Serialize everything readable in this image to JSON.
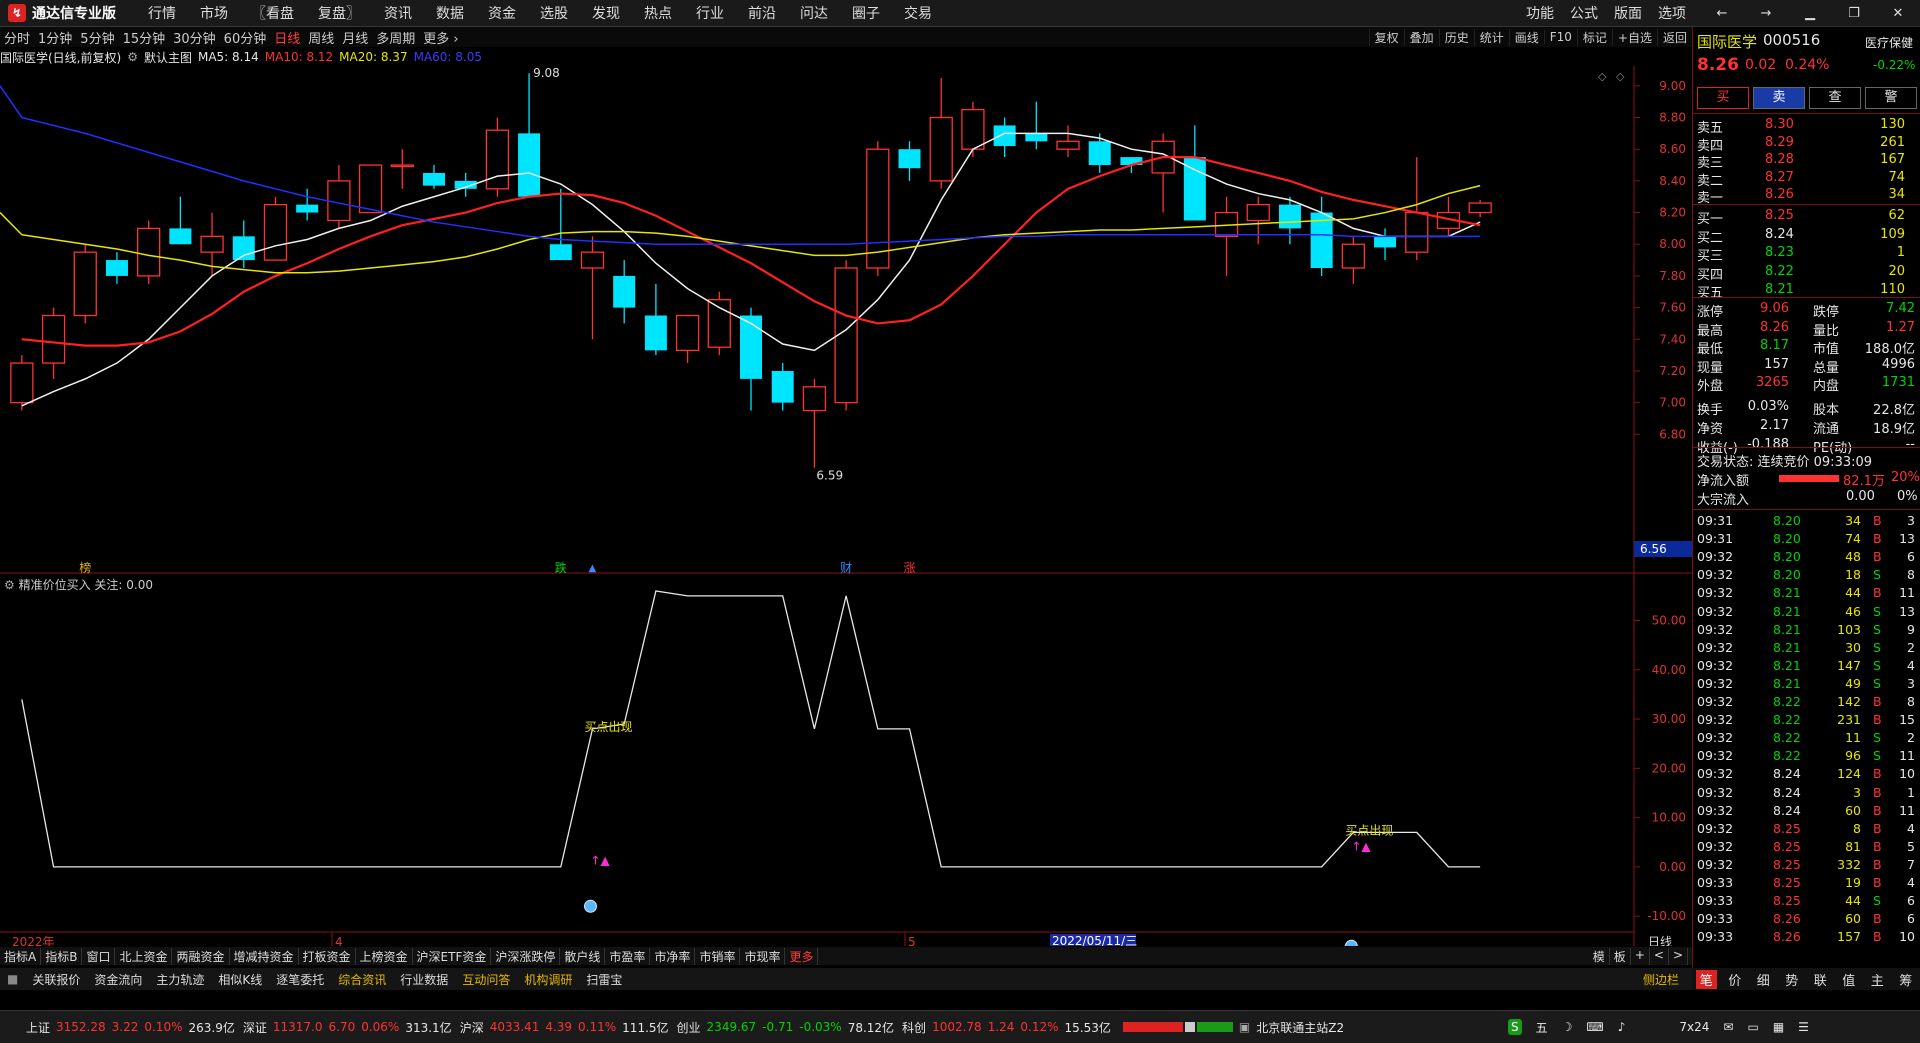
{
  "app": {
    "title": "通达信专业版"
  },
  "menu": [
    "行情",
    "市场",
    "〖看盘",
    "复盘〗",
    "资讯",
    "数据",
    "资金",
    "选股",
    "发现",
    "热点",
    "行业",
    "前沿",
    "问达",
    "圈子",
    "交易"
  ],
  "topright": [
    "功能",
    "公式",
    "版面",
    "选项"
  ],
  "periods": [
    "分时",
    "1分钟",
    "5分钟",
    "15分钟",
    "30分钟",
    "60分钟",
    "日线",
    "周线",
    "月线",
    "多周期",
    "更多 ›"
  ],
  "active_period": "日线",
  "chart_tools": [
    "复权",
    "叠加",
    "历史",
    "统计",
    "画线",
    "F10",
    "标记",
    "+自选",
    "返回"
  ],
  "infoline": {
    "name": "国际医学(日线,前复权)",
    "template": "默认主图",
    "ma5": "MA5: 8.14",
    "ma10": "MA10: 8.12",
    "ma20": "MA20: 8.37",
    "ma60": "MA60: 8.05"
  },
  "indicator_line": "精准价位买入 关注: 0.00",
  "chart_data": [
    {
      "type": "candlestick",
      "title": "国际医学(日线,前复权)",
      "ylim": [
        6.6,
        9.1
      ],
      "y_ticks": [
        "9.00",
        "8.80",
        "8.60",
        "8.40",
        "8.20",
        "8.00",
        "7.80",
        "7.60",
        "7.40",
        "7.20",
        "7.00",
        "6.80"
      ],
      "annotations": [
        {
          "text": "9.08",
          "value": 9.08
        },
        {
          "text": "6.59",
          "value": 6.59
        }
      ],
      "current_price_tag": "6.56",
      "x_tick_labels": [
        "2022年",
        "4",
        "5"
      ],
      "cursor_date": "2022/05/11/三",
      "event_marks": [
        "榜",
        "跌",
        "财",
        "涨"
      ],
      "candles": [
        {
          "o": 7.0,
          "h": 7.3,
          "l": 6.95,
          "c": 7.25
        },
        {
          "o": 7.25,
          "h": 7.6,
          "l": 7.15,
          "c": 7.55
        },
        {
          "o": 7.55,
          "h": 8.0,
          "l": 7.5,
          "c": 7.95
        },
        {
          "o": 7.9,
          "h": 7.95,
          "l": 7.75,
          "c": 7.8
        },
        {
          "o": 7.8,
          "h": 8.15,
          "l": 7.75,
          "c": 8.1
        },
        {
          "o": 8.1,
          "h": 8.3,
          "l": 8.0,
          "c": 8.0
        },
        {
          "o": 7.95,
          "h": 8.2,
          "l": 7.8,
          "c": 8.05
        },
        {
          "o": 8.05,
          "h": 8.15,
          "l": 7.85,
          "c": 7.9
        },
        {
          "o": 7.9,
          "h": 8.3,
          "l": 7.9,
          "c": 8.25
        },
        {
          "o": 8.25,
          "h": 8.35,
          "l": 8.15,
          "c": 8.2
        },
        {
          "o": 8.15,
          "h": 8.5,
          "l": 8.1,
          "c": 8.4
        },
        {
          "o": 8.2,
          "h": 8.5,
          "l": 8.2,
          "c": 8.5
        },
        {
          "o": 8.5,
          "h": 8.6,
          "l": 8.35,
          "c": 8.5
        },
        {
          "o": 8.45,
          "h": 8.5,
          "l": 8.35,
          "c": 8.37
        },
        {
          "o": 8.4,
          "h": 8.45,
          "l": 8.3,
          "c": 8.35
        },
        {
          "o": 8.35,
          "h": 8.8,
          "l": 8.3,
          "c": 8.72
        },
        {
          "o": 8.7,
          "h": 9.08,
          "l": 8.3,
          "c": 8.3
        },
        {
          "o": 8.0,
          "h": 8.35,
          "l": 7.9,
          "c": 7.9
        },
        {
          "o": 7.85,
          "h": 8.05,
          "l": 7.4,
          "c": 7.95
        },
        {
          "o": 7.8,
          "h": 7.9,
          "l": 7.5,
          "c": 7.6
        },
        {
          "o": 7.55,
          "h": 7.75,
          "l": 7.3,
          "c": 7.33
        },
        {
          "o": 7.33,
          "h": 7.5,
          "l": 7.25,
          "c": 7.55
        },
        {
          "o": 7.35,
          "h": 7.7,
          "l": 7.3,
          "c": 7.65
        },
        {
          "o": 7.55,
          "h": 7.6,
          "l": 6.95,
          "c": 7.15
        },
        {
          "o": 7.2,
          "h": 7.25,
          "l": 6.95,
          "c": 7.0
        },
        {
          "o": 6.95,
          "h": 7.15,
          "l": 6.59,
          "c": 7.1
        },
        {
          "o": 7.0,
          "h": 7.9,
          "l": 6.95,
          "c": 7.85
        },
        {
          "o": 7.85,
          "h": 8.65,
          "l": 7.8,
          "c": 8.6
        },
        {
          "o": 8.6,
          "h": 8.65,
          "l": 8.4,
          "c": 8.48
        },
        {
          "o": 8.4,
          "h": 9.05,
          "l": 8.35,
          "c": 8.8
        },
        {
          "o": 8.6,
          "h": 8.9,
          "l": 8.55,
          "c": 8.85
        },
        {
          "o": 8.75,
          "h": 8.8,
          "l": 8.55,
          "c": 8.62
        },
        {
          "o": 8.7,
          "h": 8.9,
          "l": 8.6,
          "c": 8.65
        },
        {
          "o": 8.6,
          "h": 8.75,
          "l": 8.55,
          "c": 8.65
        },
        {
          "o": 8.65,
          "h": 8.7,
          "l": 8.45,
          "c": 8.5
        },
        {
          "o": 8.55,
          "h": 8.55,
          "l": 8.45,
          "c": 8.5
        },
        {
          "o": 8.45,
          "h": 8.7,
          "l": 8.2,
          "c": 8.65
        },
        {
          "o": 8.55,
          "h": 8.75,
          "l": 8.15,
          "c": 8.15
        },
        {
          "o": 8.05,
          "h": 8.3,
          "l": 7.8,
          "c": 8.2
        },
        {
          "o": 8.15,
          "h": 8.3,
          "l": 8.0,
          "c": 8.25
        },
        {
          "o": 8.25,
          "h": 8.3,
          "l": 8.0,
          "c": 8.1
        },
        {
          "o": 8.2,
          "h": 8.3,
          "l": 7.8,
          "c": 7.85
        },
        {
          "o": 7.85,
          "h": 8.05,
          "l": 7.75,
          "c": 8.0
        },
        {
          "o": 8.05,
          "h": 8.1,
          "l": 7.9,
          "c": 7.98
        },
        {
          "o": 7.95,
          "h": 8.55,
          "l": 7.9,
          "c": 8.2
        },
        {
          "o": 8.1,
          "h": 8.3,
          "l": 8.05,
          "c": 8.2
        },
        {
          "o": 8.2,
          "h": 8.28,
          "l": 8.17,
          "c": 8.26
        }
      ],
      "ma_lines": {
        "MA5": [
          6.98,
          7.07,
          7.15,
          7.25,
          7.4,
          7.6,
          7.8,
          7.93,
          7.99,
          8.03,
          8.1,
          8.15,
          8.24,
          8.3,
          8.36,
          8.43,
          8.45,
          8.38,
          8.25,
          8.08,
          7.88,
          7.72,
          7.6,
          7.5,
          7.37,
          7.33,
          7.46,
          7.65,
          7.9,
          8.28,
          8.6,
          8.7,
          8.7,
          8.7,
          8.67,
          8.6,
          8.57,
          8.47,
          8.38,
          8.32,
          8.28,
          8.2,
          8.1,
          8.05,
          8.05,
          8.05,
          8.14
        ],
        "MA10": [
          7.4,
          7.38,
          7.36,
          7.36,
          7.38,
          7.45,
          7.56,
          7.7,
          7.8,
          7.88,
          7.97,
          8.05,
          8.12,
          8.16,
          8.2,
          8.26,
          8.3,
          8.32,
          8.31,
          8.26,
          8.18,
          8.08,
          7.98,
          7.88,
          7.76,
          7.64,
          7.55,
          7.5,
          7.52,
          7.62,
          7.8,
          8.0,
          8.2,
          8.35,
          8.43,
          8.5,
          8.55,
          8.55,
          8.5,
          8.45,
          8.4,
          8.33,
          8.28,
          8.24,
          8.2,
          8.16,
          8.12
        ],
        "MA20": [
          8.06,
          8.03,
          8.0,
          7.97,
          7.93,
          7.9,
          7.86,
          7.84,
          7.82,
          7.82,
          7.83,
          7.85,
          7.87,
          7.89,
          7.92,
          7.97,
          8.03,
          8.07,
          8.08,
          8.08,
          8.07,
          8.05,
          8.02,
          7.99,
          7.96,
          7.93,
          7.93,
          7.95,
          7.98,
          8.01,
          8.04,
          8.06,
          8.07,
          8.08,
          8.09,
          8.09,
          8.1,
          8.11,
          8.12,
          8.13,
          8.14,
          8.15,
          8.16,
          8.2,
          8.25,
          8.32,
          8.37
        ],
        "MA60": [
          8.8,
          8.75,
          8.7,
          8.64,
          8.58,
          8.52,
          8.46,
          8.4,
          8.35,
          8.3,
          8.26,
          8.22,
          8.18,
          8.14,
          8.11,
          8.08,
          8.05,
          8.03,
          8.02,
          8.01,
          8.0,
          8.0,
          8.0,
          8.0,
          8.0,
          8.0,
          8.0,
          8.01,
          8.02,
          8.03,
          8.04,
          8.05,
          8.05,
          8.06,
          8.06,
          8.06,
          8.06,
          8.06,
          8.06,
          8.06,
          8.06,
          8.06,
          8.05,
          8.05,
          8.05,
          8.05,
          8.05
        ]
      }
    },
    {
      "type": "line",
      "title": "精准价位买入",
      "ylim": [
        -12,
        57
      ],
      "y_ticks": [
        "50.00",
        "40.00",
        "30.00",
        "20.00",
        "10.00",
        "0.00",
        "-10.00"
      ],
      "values": [
        34,
        0,
        0,
        0,
        0,
        0,
        0,
        0,
        0,
        0,
        0,
        0,
        0,
        0,
        0,
        0,
        0,
        0,
        28,
        29,
        56,
        55,
        55,
        55,
        55,
        28,
        55,
        28,
        28,
        0,
        0,
        0,
        0,
        0,
        0,
        0,
        0,
        0,
        0,
        0,
        0,
        0,
        7,
        7,
        7,
        0,
        0
      ],
      "annotations": [
        {
          "text": "买点出现",
          "index": 18
        },
        {
          "text": "买点出现",
          "index": 42
        }
      ]
    }
  ],
  "bottom_x_label": "日线",
  "stock": {
    "name": "国际医学",
    "code": "000516",
    "sector": "医疗保健",
    "sector_change": "-0.22%",
    "price": "8.26",
    "change": "0.02",
    "change_pct": "0.24%"
  },
  "trade_buttons": [
    "买",
    "卖",
    "查",
    "警"
  ],
  "order_book": {
    "asks": [
      {
        "label": "卖五",
        "price": "8.30",
        "vol": "130"
      },
      {
        "label": "卖四",
        "price": "8.29",
        "vol": "261"
      },
      {
        "label": "卖三",
        "price": "8.28",
        "vol": "167"
      },
      {
        "label": "卖二",
        "price": "8.27",
        "vol": "74"
      },
      {
        "label": "卖一",
        "price": "8.26",
        "vol": "34"
      }
    ],
    "bids": [
      {
        "label": "买一",
        "price": "8.25",
        "vol": "62"
      },
      {
        "label": "买二",
        "price": "8.24",
        "vol": "109"
      },
      {
        "label": "买三",
        "price": "8.23",
        "vol": "1"
      },
      {
        "label": "买四",
        "price": "8.22",
        "vol": "20"
      },
      {
        "label": "买五",
        "price": "8.21",
        "vol": "110"
      }
    ]
  },
  "stats": [
    {
      "k1": "涨停",
      "v1": "9.06",
      "k2": "跌停",
      "v2": "7.42",
      "c1": "red",
      "c2": "green"
    },
    {
      "k1": "最高",
      "v1": "8.26",
      "k2": "量比",
      "v2": "1.27",
      "c1": "red",
      "c2": "red"
    },
    {
      "k1": "最低",
      "v1": "8.17",
      "k2": "市值",
      "v2": "188.0亿",
      "c1": "green",
      "c2": "white"
    },
    {
      "k1": "现量",
      "v1": "157",
      "k2": "总量",
      "v2": "4996",
      "c1": "white",
      "c2": "white"
    },
    {
      "k1": "外盘",
      "v1": "3265",
      "k2": "内盘",
      "v2": "1731",
      "c1": "red",
      "c2": "green"
    },
    {
      "k1": "换手",
      "v1": "0.03%",
      "k2": "股本",
      "v2": "22.8亿",
      "c1": "white",
      "c2": "white"
    },
    {
      "k1": "净资",
      "v1": "2.17",
      "k2": "流通",
      "v2": "18.9亿",
      "c1": "white",
      "c2": "white"
    },
    {
      "k1": "收益(-)",
      "v1": "-0.188",
      "k2": "PE(动)",
      "v2": "--",
      "c1": "white",
      "c2": "white"
    }
  ],
  "trade_status": "交易状态: 连续竞价 09:33:09",
  "net_inflow": {
    "label": "净流入额",
    "value": "82.1万",
    "pct": "20%"
  },
  "block_inflow": {
    "label": "大宗流入",
    "value": "0.00",
    "pct": "0%"
  },
  "ticks": [
    {
      "t": "09:31",
      "p": "8.20",
      "v": "34",
      "d": "B",
      "n": "3"
    },
    {
      "t": "09:31",
      "p": "8.20",
      "v": "74",
      "d": "B",
      "n": "13"
    },
    {
      "t": "09:32",
      "p": "8.20",
      "v": "48",
      "d": "B",
      "n": "6"
    },
    {
      "t": "09:32",
      "p": "8.20",
      "v": "18",
      "d": "S",
      "n": "8"
    },
    {
      "t": "09:32",
      "p": "8.21",
      "v": "44",
      "d": "B",
      "n": "11"
    },
    {
      "t": "09:32",
      "p": "8.21",
      "v": "46",
      "d": "S",
      "n": "13"
    },
    {
      "t": "09:32",
      "p": "8.21",
      "v": "103",
      "d": "S",
      "n": "9"
    },
    {
      "t": "09:32",
      "p": "8.21",
      "v": "30",
      "d": "S",
      "n": "2"
    },
    {
      "t": "09:32",
      "p": "8.21",
      "v": "147",
      "d": "S",
      "n": "4"
    },
    {
      "t": "09:32",
      "p": "8.21",
      "v": "49",
      "d": "S",
      "n": "3"
    },
    {
      "t": "09:32",
      "p": "8.22",
      "v": "142",
      "d": "B",
      "n": "8"
    },
    {
      "t": "09:32",
      "p": "8.22",
      "v": "231",
      "d": "B",
      "n": "15"
    },
    {
      "t": "09:32",
      "p": "8.22",
      "v": "11",
      "d": "S",
      "n": "2"
    },
    {
      "t": "09:32",
      "p": "8.22",
      "v": "96",
      "d": "S",
      "n": "11"
    },
    {
      "t": "09:32",
      "p": "8.24",
      "v": "124",
      "d": "B",
      "n": "10"
    },
    {
      "t": "09:32",
      "p": "8.24",
      "v": "3",
      "d": "B",
      "n": "1"
    },
    {
      "t": "09:32",
      "p": "8.24",
      "v": "60",
      "d": "B",
      "n": "11"
    },
    {
      "t": "09:32",
      "p": "8.25",
      "v": "8",
      "d": "B",
      "n": "4"
    },
    {
      "t": "09:32",
      "p": "8.25",
      "v": "81",
      "d": "B",
      "n": "5"
    },
    {
      "t": "09:32",
      "p": "8.25",
      "v": "332",
      "d": "B",
      "n": "7"
    },
    {
      "t": "09:33",
      "p": "8.25",
      "v": "19",
      "d": "B",
      "n": "4"
    },
    {
      "t": "09:33",
      "p": "8.25",
      "v": "44",
      "d": "S",
      "n": "6"
    },
    {
      "t": "09:33",
      "p": "8.26",
      "v": "60",
      "d": "B",
      "n": "6"
    },
    {
      "t": "09:33",
      "p": "8.26",
      "v": "157",
      "d": "B",
      "n": "10"
    }
  ],
  "tabbar1": [
    "指标A",
    "指标B",
    "窗口",
    "北上资金",
    "两融资金",
    "增减持资金",
    "打板资金",
    "上榜资金",
    "沪深ETF资金",
    "沪深涨跌停",
    "散户线",
    "市盈率",
    "市净率",
    "市销率",
    "市现率",
    "更多"
  ],
  "tabbar1_right": [
    "模",
    "板",
    "+",
    "<",
    ">"
  ],
  "tabbar2": [
    "关联报价",
    "资金流向",
    "主力轨迹",
    "相似K线",
    "逐笔委托",
    "综合资讯",
    "行业数据",
    "互动问答",
    "机构调研",
    "扫雷宝"
  ],
  "tabbar2_right": "侧边栏",
  "rtabs": [
    "笔",
    "价",
    "细",
    "势",
    "联",
    "值",
    "主",
    "筹"
  ],
  "statusbar": [
    {
      "label": "上证",
      "value": "3152.28",
      "chg": "3.22",
      "pct": "0.10%",
      "amt": "263.9亿"
    },
    {
      "label": "深证",
      "value": "11317.0",
      "chg": "6.70",
      "pct": "0.06%",
      "amt": "313.1亿"
    },
    {
      "label": "沪深",
      "value": "4033.41",
      "chg": "4.39",
      "pct": "0.11%",
      "amt": "111.5亿"
    },
    {
      "label": "创业",
      "value": "2349.67",
      "chg": "-0.71",
      "pct": "-0.03%",
      "amt": "78.12亿"
    },
    {
      "label": "科创",
      "value": "1002.78",
      "chg": "1.24",
      "pct": "0.12%",
      "amt": "15.53亿"
    }
  ],
  "server": "北京联通主站Z2",
  "status_right": [
    "五",
    "7x24"
  ]
}
